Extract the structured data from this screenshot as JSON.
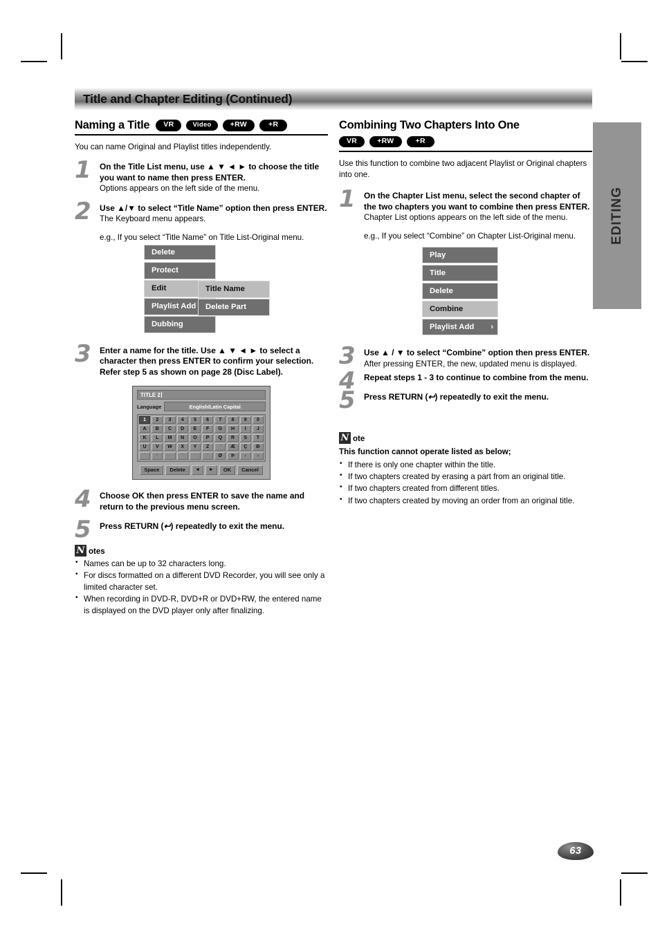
{
  "page": {
    "banner_title": "Title and Chapter Editing (Continued)",
    "side_tab": "EDITING",
    "page_number": "63"
  },
  "left": {
    "section_title": "Naming a Title",
    "badges": [
      "VR",
      "Video",
      "+RW",
      "+R"
    ],
    "intro": "You can name Original and Playlist titles independently.",
    "steps": [
      {
        "num": "1",
        "bold": "On the Title List menu, use ▲ ▼ ◄ ► to choose the title you want to name then press ENTER.",
        "plain": "Options appears on the left side of the menu."
      },
      {
        "num": "2",
        "bold": "Use ▲/▼ to select “Title Name” option then press ENTER.",
        "plain": "The Keyboard menu appears.",
        "plain2": "e.g., If you select “Title Name” on Title List-Original menu."
      },
      {
        "num": "3",
        "bold": "Enter a name for the title. Use ▲ ▼ ◄ ► to select a character then press ENTER to confirm your selection. Refer step 5 as shown on page 28 (Disc Label)."
      },
      {
        "num": "4",
        "bold": "Choose OK then press ENTER to save the name and return to the previous menu screen."
      },
      {
        "num": "5",
        "bold_pre": "Press RETURN (",
        "bold_icon": "↩",
        "bold_post": ") repeatedly to exit the menu."
      }
    ],
    "menu": {
      "items": [
        {
          "label": "Delete",
          "highlighted": false
        },
        {
          "label": "Protect",
          "highlighted": false
        },
        {
          "label": "Edit",
          "highlighted": true
        },
        {
          "label": "Playlist Add",
          "highlighted": false
        },
        {
          "label": "Dubbing",
          "highlighted": false
        }
      ],
      "submenu": [
        {
          "label": "Title Name",
          "highlighted": true
        },
        {
          "label": "Delete Part",
          "highlighted": false
        }
      ]
    },
    "keyboard": {
      "title_value": "TITLE 2",
      "language_label": "Language",
      "language_value": "English/Latin Capital",
      "rows": [
        [
          "1",
          "2",
          "3",
          "4",
          "5",
          "6",
          "7",
          "8",
          "9",
          "0"
        ],
        [
          "A",
          "B",
          "C",
          "D",
          "E",
          "F",
          "G",
          "H",
          "I",
          "J"
        ],
        [
          "K",
          "L",
          "M",
          "N",
          "O",
          "P",
          "Q",
          "R",
          "S",
          "T"
        ],
        [
          "U",
          "V",
          "W",
          "X",
          "Y",
          "Z",
          "’",
          "Æ",
          "Ç",
          "Ð"
        ],
        [
          "´",
          "°",
          "·",
          "¯",
          "¨",
          "ˇ",
          "Ø",
          "Þ",
          "«",
          "»"
        ]
      ],
      "selected_key": "1",
      "buttons": [
        "Space",
        "Delete",
        "◄",
        "►",
        "OK",
        "Cancel"
      ]
    },
    "notes": {
      "badge_letter": "N",
      "label": "otes",
      "items": [
        "Names can be up to 32 characters long.",
        "For discs formatted on a different DVD Recorder, you will see only a limited character set.",
        "When recording in DVD-R, DVD+R or DVD+RW, the entered name is displayed on the DVD player only after finalizing."
      ]
    }
  },
  "right": {
    "section_title": "Combining Two Chapters Into One",
    "badges": [
      "VR",
      "+RW",
      "+R"
    ],
    "intro": "Use this function to combine two adjacent Playlist or Original chapters into one.",
    "steps": [
      {
        "num": "1",
        "bold": "On the Chapter List menu, select the second chapter of the two chapters you want to combine then press ENTER.",
        "plain": "Chapter List options appears on the left side of the menu.",
        "plain2": "e.g., If you select “Combine” on Chapter List-Original menu."
      },
      {
        "num": "3",
        "bold": "Use ▲ / ▼ to select “Combine” option then press ENTER.",
        "plain": "After pressing ENTER, the new, updated menu is displayed."
      },
      {
        "num": "4",
        "bold": "Repeat steps 1 - 3 to continue to combine from the menu."
      },
      {
        "num": "5",
        "bold_pre": "Press RETURN (",
        "bold_icon": "↩",
        "bold_post": ") repeatedly to exit the menu."
      }
    ],
    "menu": {
      "items": [
        {
          "label": "Play",
          "highlighted": false,
          "arrow": ""
        },
        {
          "label": "Title",
          "highlighted": false,
          "arrow": ""
        },
        {
          "label": "Delete",
          "highlighted": false,
          "arrow": ""
        },
        {
          "label": "Combine",
          "highlighted": true,
          "arrow": ""
        },
        {
          "label": "Playlist Add",
          "highlighted": false,
          "arrow": "›"
        }
      ]
    },
    "note": {
      "badge_letter": "N",
      "label": "ote",
      "subhead": "This function cannot operate listed as below;",
      "items": [
        "If there is only one chapter within the title.",
        "If two chapters created by erasing a part from an original title.",
        "If two chapters created from different titles.",
        "If two chapters created by moving an order from an original title."
      ]
    }
  }
}
